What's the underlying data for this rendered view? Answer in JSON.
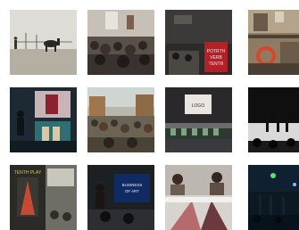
{
  "gallery": {
    "tiles": [
      {
        "name": "gallery-photo-stage-horse",
        "text": ""
      },
      {
        "name": "gallery-photo-crowd-hall",
        "text": ""
      },
      {
        "name": "gallery-photo-sign-poster",
        "text": "POTRTH VERB TENTR"
      },
      {
        "name": "gallery-photo-balcony-lifebuoy",
        "text": ""
      },
      {
        "name": "gallery-photo-projection-screens",
        "text": ""
      },
      {
        "name": "gallery-photo-outdoor-crowd",
        "text": ""
      },
      {
        "name": "gallery-photo-stage-logo",
        "text": "LOGO"
      },
      {
        "name": "gallery-photo-dark-stage",
        "text": ""
      },
      {
        "name": "gallery-photo-poster-theatre",
        "text": "TENTH PLAY"
      },
      {
        "name": "gallery-photo-presentation-screen",
        "text": "BUSINESS OF ART"
      },
      {
        "name": "gallery-photo-people-reading",
        "text": ""
      },
      {
        "name": "gallery-photo-night-street",
        "text": ""
      }
    ]
  }
}
